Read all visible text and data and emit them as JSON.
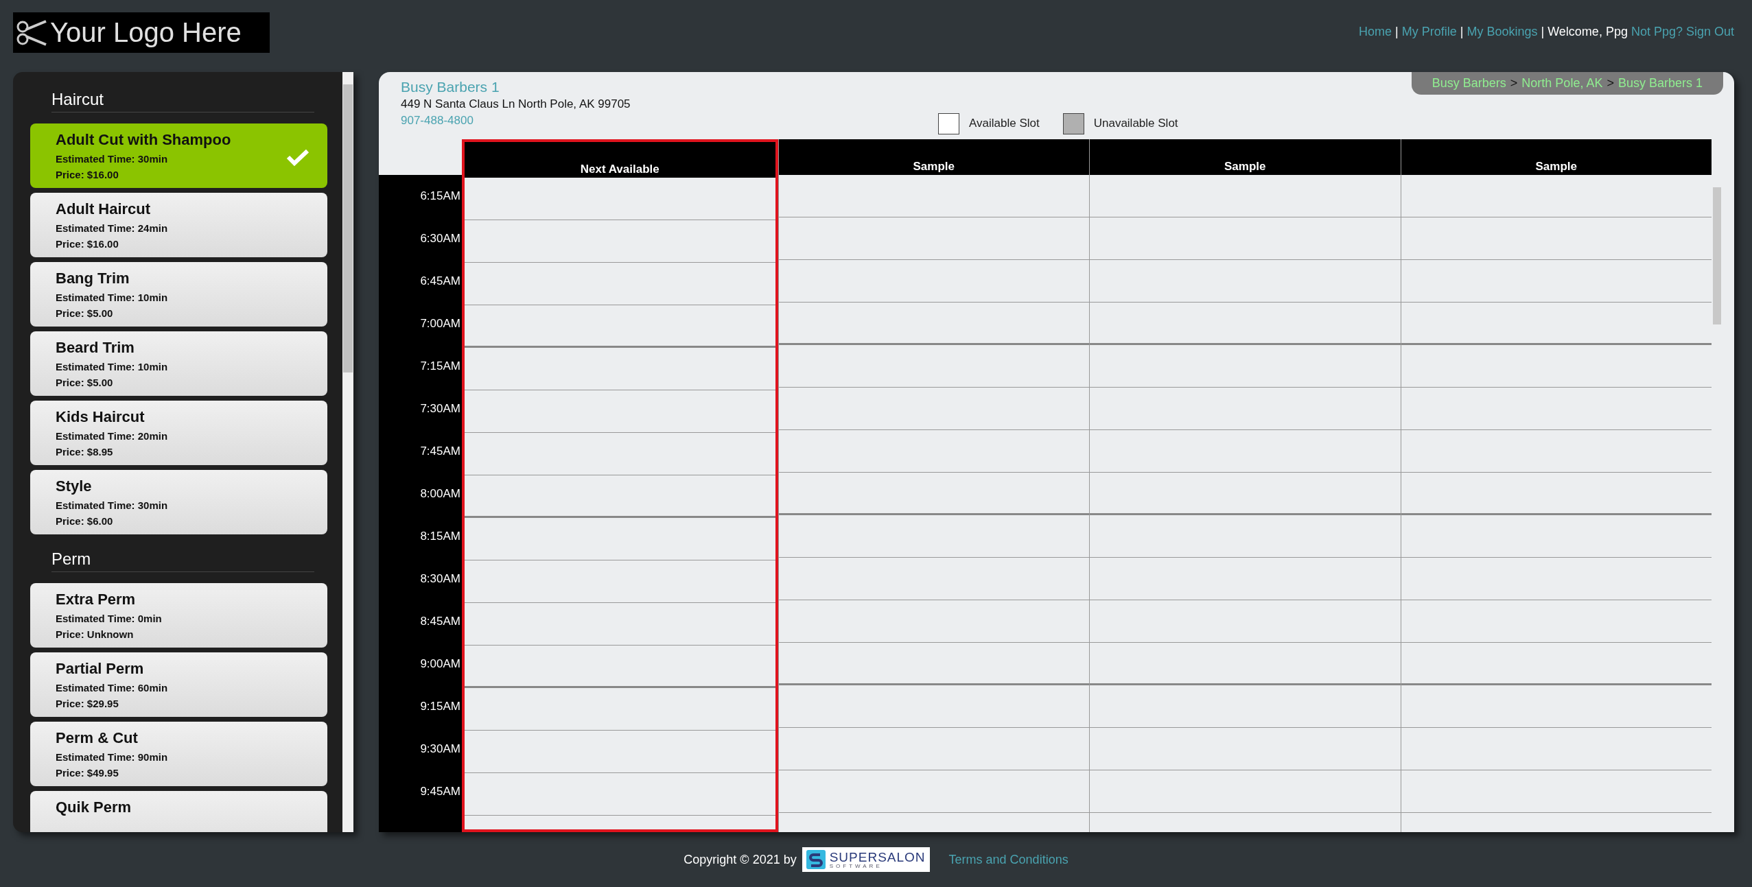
{
  "logo": {
    "text": "Your Logo Here"
  },
  "nav": [
    {
      "kind": "link",
      "text": "Home"
    },
    {
      "kind": "separator",
      "text": "|"
    },
    {
      "kind": "link",
      "text": "My Profile"
    },
    {
      "kind": "separator",
      "text": "|"
    },
    {
      "kind": "link",
      "text": "My Bookings"
    },
    {
      "kind": "separator",
      "text": "|"
    },
    {
      "kind": "text",
      "text": "Welcome, Ppg"
    },
    {
      "kind": "link",
      "text": "Not Ppg? Sign Out"
    }
  ],
  "sidebar": {
    "categories": [
      {
        "title": "Haircut",
        "services": [
          {
            "name": "Adult Cut with Shampoo",
            "time": "Estimated Time: 30min",
            "price": "Price: $16.00",
            "selected": true
          },
          {
            "name": "Adult Haircut",
            "time": "Estimated Time: 24min",
            "price": "Price: $16.00",
            "selected": false
          },
          {
            "name": "Bang Trim",
            "time": "Estimated Time: 10min",
            "price": "Price: $5.00",
            "selected": false
          },
          {
            "name": "Beard Trim",
            "time": "Estimated Time: 10min",
            "price": "Price: $5.00",
            "selected": false
          },
          {
            "name": "Kids Haircut",
            "time": "Estimated Time: 20min",
            "price": "Price: $8.95",
            "selected": false
          },
          {
            "name": "Style",
            "time": "Estimated Time: 30min",
            "price": "Price: $6.00",
            "selected": false
          }
        ]
      },
      {
        "title": "Perm",
        "services": [
          {
            "name": "Extra Perm",
            "time": "Estimated Time: 0min",
            "price": "Price: Unknown",
            "selected": false
          },
          {
            "name": "Partial Perm",
            "time": "Estimated Time: 60min",
            "price": "Price: $29.95",
            "selected": false
          },
          {
            "name": "Perm & Cut",
            "time": "Estimated Time: 90min",
            "price": "Price: $49.95",
            "selected": false
          },
          {
            "name": "Quik Perm",
            "selected": false
          }
        ]
      }
    ]
  },
  "location": {
    "name": "Busy Barbers 1",
    "address": "449 N Santa Claus Ln North Pole, AK 99705",
    "phone": "907-488-4800"
  },
  "breadcrumb": [
    {
      "kind": "link",
      "text": "Busy Barbers"
    },
    {
      "kind": "separator",
      "text": ">"
    },
    {
      "kind": "link",
      "text": "North Pole, AK"
    },
    {
      "kind": "separator",
      "text": ">"
    },
    {
      "kind": "link",
      "text": "Busy Barbers 1"
    }
  ],
  "legend": [
    {
      "kind": "available",
      "label": "Available Slot"
    },
    {
      "kind": "unavailable",
      "label": "Unavailable Slot"
    }
  ],
  "schedule": {
    "columns": [
      {
        "title": "Next Available",
        "highlighted": true
      },
      {
        "title": "Sample",
        "highlighted": false
      },
      {
        "title": "Sample",
        "highlighted": false
      },
      {
        "title": "Sample",
        "highlighted": false
      }
    ],
    "times": [
      "6:15AM",
      "6:30AM",
      "6:45AM",
      "7:00AM",
      "7:15AM",
      "7:30AM",
      "7:45AM",
      "8:00AM",
      "8:15AM",
      "8:30AM",
      "8:45AM",
      "9:00AM",
      "9:15AM",
      "9:30AM",
      "9:45AM"
    ]
  },
  "footer": {
    "copyright": "Copyright © 2021 by",
    "brand": "SUPERSALON",
    "brand_sub": "SOFTWARE",
    "link": "Terms and Conditions"
  }
}
